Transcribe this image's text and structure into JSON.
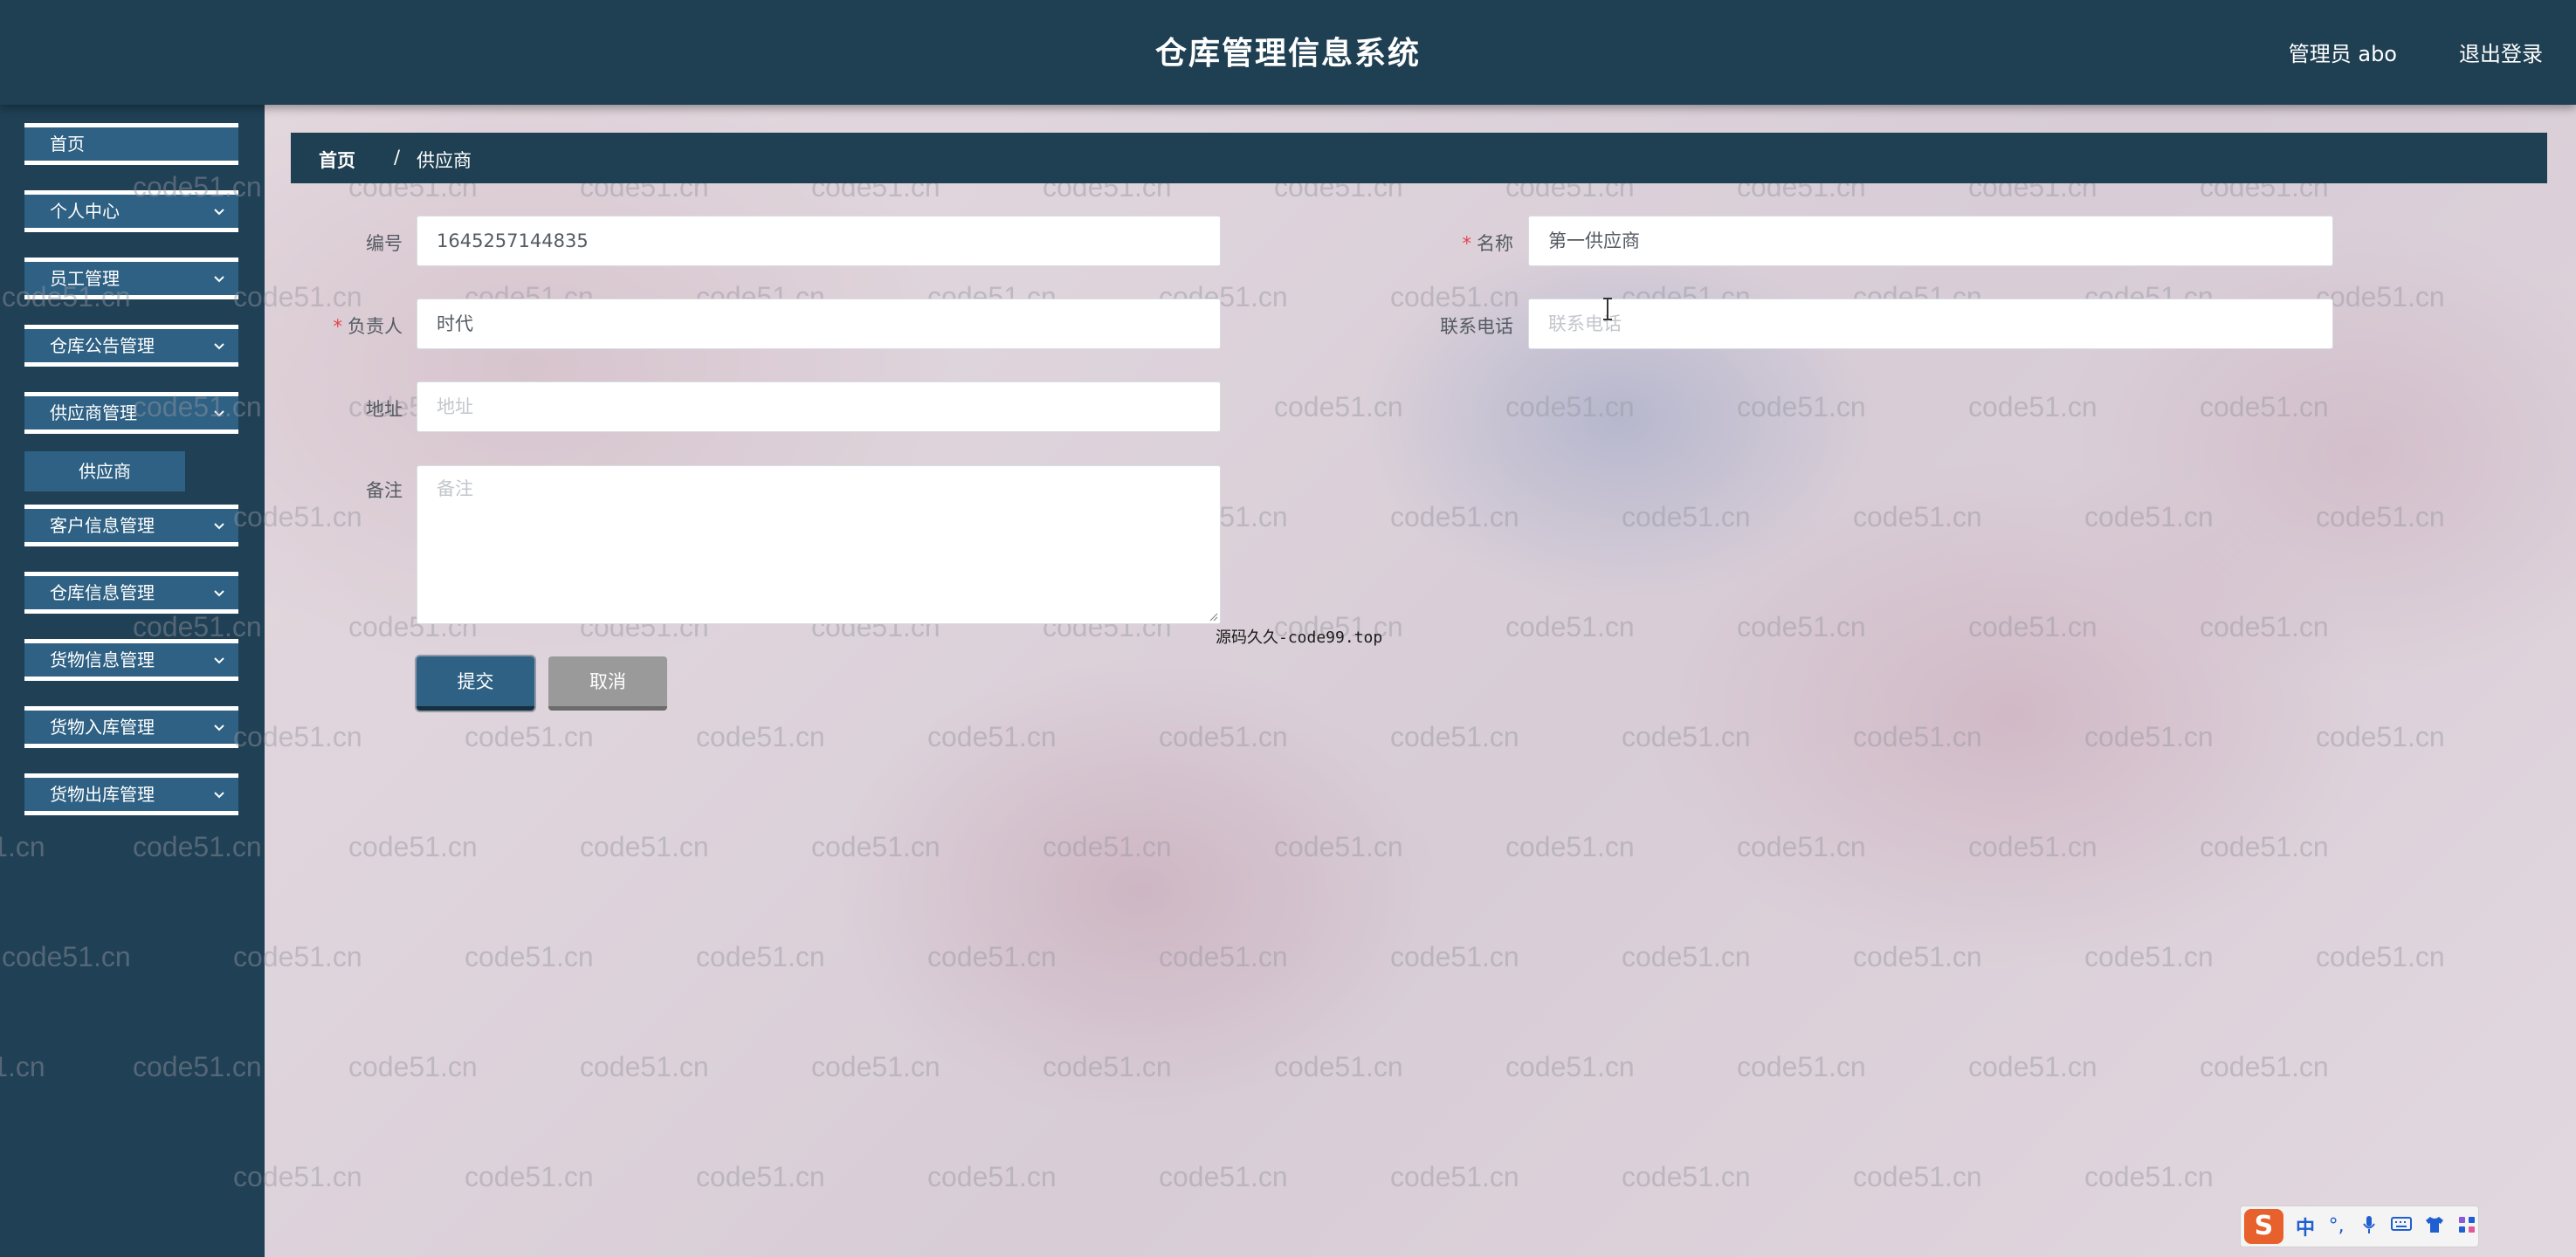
{
  "header": {
    "title": "仓库管理信息系统",
    "user_label": "管理员 abo",
    "logout_label": "退出登录"
  },
  "sidebar": {
    "items": [
      {
        "label": "首页",
        "has_chevron": false
      },
      {
        "label": "个人中心",
        "has_chevron": true
      },
      {
        "label": "员工管理",
        "has_chevron": true
      },
      {
        "label": "仓库公告管理",
        "has_chevron": true
      },
      {
        "label": "供应商管理",
        "has_chevron": true,
        "expanded": true
      },
      {
        "label": "客户信息管理",
        "has_chevron": true
      },
      {
        "label": "仓库信息管理",
        "has_chevron": true
      },
      {
        "label": "货物信息管理",
        "has_chevron": true
      },
      {
        "label": "货物入库管理",
        "has_chevron": true
      },
      {
        "label": "货物出库管理",
        "has_chevron": true
      }
    ],
    "submenu": {
      "label": "供应商"
    }
  },
  "breadcrumb": {
    "home": "首页",
    "separator": "/",
    "current": "供应商"
  },
  "form": {
    "code": {
      "label": "编号",
      "value": "1645257144835",
      "required": false
    },
    "name": {
      "label": "名称",
      "value": "第一供应商",
      "required": true
    },
    "contact": {
      "label": "负责人",
      "value": "时代",
      "required": true
    },
    "phone": {
      "label": "联系电话",
      "value": "",
      "placeholder": "联系电话",
      "required": false
    },
    "address": {
      "label": "地址",
      "value": "",
      "placeholder": "地址",
      "required": false
    },
    "remark": {
      "label": "备注",
      "value": "",
      "placeholder": "备注",
      "required": false
    },
    "required_mark": "*"
  },
  "buttons": {
    "submit": "提交",
    "cancel": "取消"
  },
  "source_note": "源码久久-code99.top",
  "watermark_text": "code51.cn",
  "ime": {
    "logo": "S",
    "mode": "中",
    "icons": [
      "punctuation-icon",
      "microphone-icon",
      "keyboard-icon",
      "skin-icon",
      "apps-icon"
    ]
  },
  "colors": {
    "header_bg": "#1f3f52",
    "sidebar_bg": "#1f4055",
    "menu_item_bg": "#2e6184",
    "required_mark": "#e4434b",
    "cancel_bg": "#9a9a9a"
  }
}
